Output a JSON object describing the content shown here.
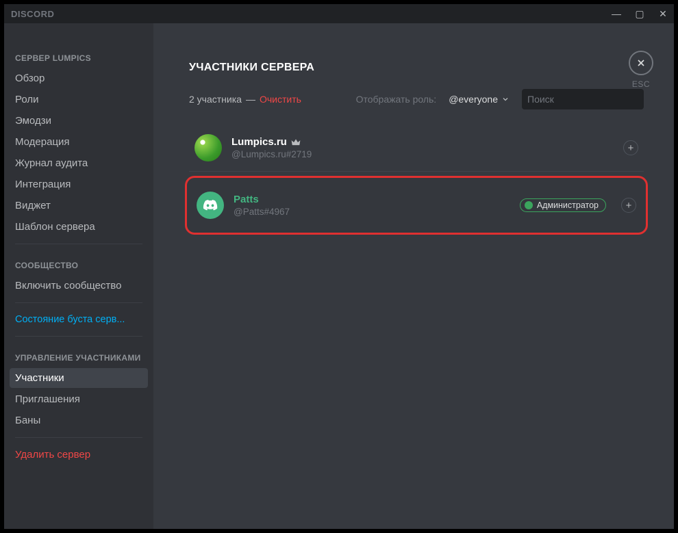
{
  "app_title": "DISCORD",
  "window": {
    "minimize": "—",
    "maximize": "▢",
    "close": "✕"
  },
  "sidebar": {
    "server_header": "СЕРВЕР LUMPICS",
    "items_server": [
      "Обзор",
      "Роли",
      "Эмодзи",
      "Модерация",
      "Журнал аудита",
      "Интеграция",
      "Виджет",
      "Шаблон сервера"
    ],
    "community_header": "СООБЩЕСТВО",
    "community_items": [
      "Включить сообщество"
    ],
    "boost_item": "Состояние буста серв...",
    "members_header": "УПРАВЛЕНИЕ УЧАСТНИКАМИ",
    "members_items": [
      "Участники",
      "Приглашения",
      "Баны"
    ],
    "delete_server": "Удалить сервер"
  },
  "main": {
    "title": "УЧАСТНИКИ СЕРВЕРА",
    "count_text": "2 участника",
    "dash": "—",
    "clear": "Очистить",
    "role_label": "Отображать роль:",
    "role_value": "@everyone",
    "search_placeholder": "Поиск",
    "members": [
      {
        "name": "Lumpics.ru",
        "tag": "@Lumpics.ru#2719",
        "owner": true,
        "roles": []
      },
      {
        "name": "Patts",
        "tag": "@Patts#4967",
        "owner": false,
        "roles": [
          "Администратор"
        ]
      }
    ]
  },
  "close": {
    "esc": "ESC"
  }
}
